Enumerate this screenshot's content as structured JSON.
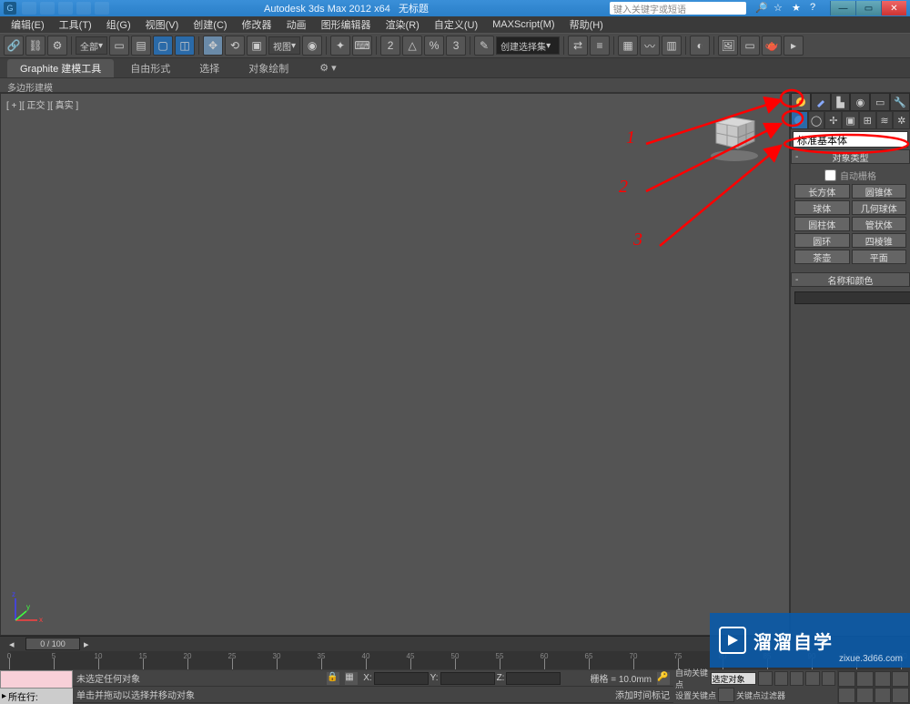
{
  "title_bar": {
    "app_title": "Autodesk 3ds Max 2012 x64",
    "doc_title": "无标题",
    "search_placeholder": "键入关键字或短语"
  },
  "menu": {
    "items": [
      "编辑(E)",
      "工具(T)",
      "组(G)",
      "视图(V)",
      "创建(C)",
      "修改器",
      "动画",
      "图形编辑器",
      "渲染(R)",
      "自定义(U)",
      "MAXScript(M)",
      "帮助(H)"
    ]
  },
  "toolbar": {
    "layer_drop": "全部",
    "view_drop": "视图",
    "selset_drop": "创建选择集"
  },
  "ribbon": {
    "title": "Graphite 建模工具",
    "tabs": [
      "自由形式",
      "选择",
      "对象绘制"
    ],
    "sub": "多边形建模"
  },
  "viewport": {
    "label": "[ + ][ 正交 ][ 真实 ]"
  },
  "cmd_panel": {
    "primitive_drop": "标准基本体",
    "rollout_type": "对象类型",
    "auto_grid": "自动栅格",
    "primitives": [
      [
        "长方体",
        "圆锥体"
      ],
      [
        "球体",
        "几何球体"
      ],
      [
        "圆柱体",
        "管状体"
      ],
      [
        "圆环",
        "四棱锥"
      ],
      [
        "茶壶",
        "平面"
      ]
    ],
    "rollout_name": "名称和颜色"
  },
  "timeline": {
    "slider_label": "0 / 100"
  },
  "status": {
    "no_selection": "未选定任何对象",
    "prompt": "单击并拖动以选择并移动对象",
    "now_label": "所在行:",
    "grid_label": "栅格 = 10.0mm",
    "x": "X:",
    "y": "Y:",
    "z": "Z:",
    "autokey": "自动关键点",
    "setkey": "设置关键点",
    "selset": "选定对象",
    "keyfilter": "关键点过滤器",
    "addtime": "添加时间标记"
  },
  "watermark": {
    "text": "溜溜自学",
    "url": "zixue.3d66.com"
  },
  "annotations": {
    "n1": "1",
    "n2": "2",
    "n3": "3"
  }
}
